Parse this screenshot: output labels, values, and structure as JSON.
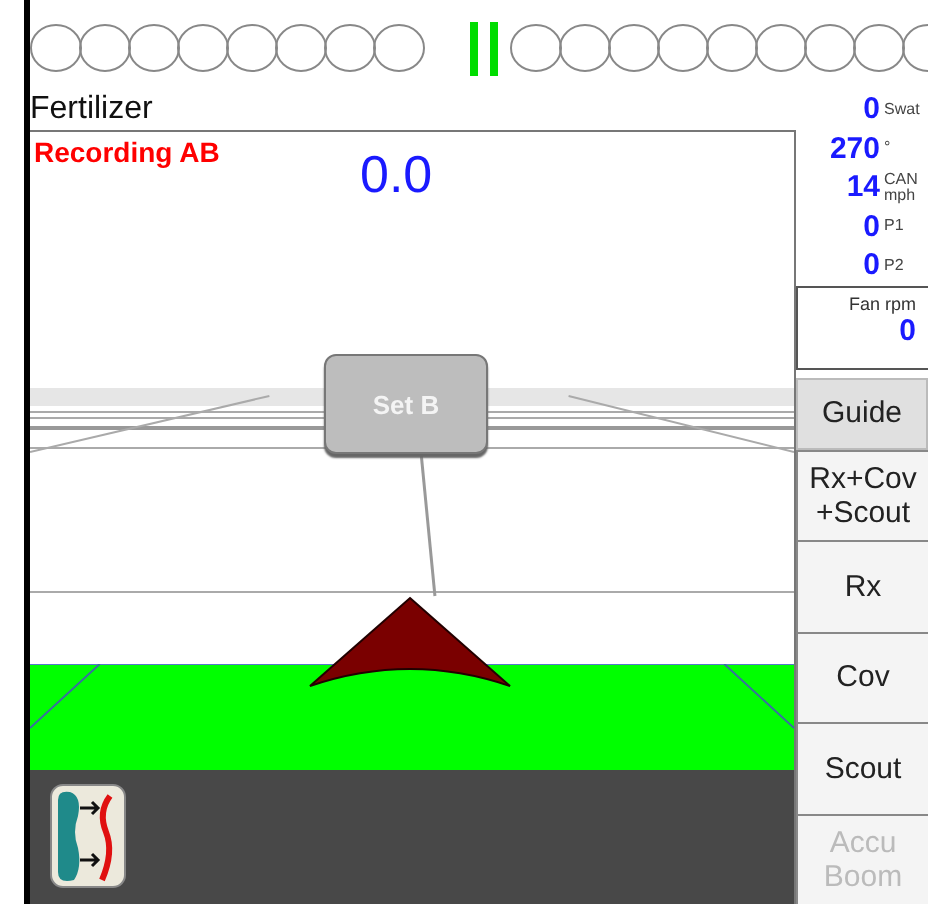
{
  "product": "Fertilizer",
  "view": {
    "status": "Recording AB",
    "value": "0.0",
    "set_button": "Set B"
  },
  "readouts": [
    {
      "value": "0",
      "unit": "Swat"
    },
    {
      "value": "270",
      "unit": "°"
    },
    {
      "value": "14",
      "unit": "CAN mph"
    },
    {
      "value": "0",
      "unit": "P1"
    },
    {
      "value": "0",
      "unit": "P2"
    }
  ],
  "fan": {
    "label": "Fan rpm",
    "value": "0"
  },
  "buttons": [
    {
      "label": "Guide",
      "kind": "guide",
      "disabled": false
    },
    {
      "label": "Rx+Cov +Scout",
      "kind": "mode",
      "disabled": false
    },
    {
      "label": "Rx",
      "kind": "mode",
      "disabled": false
    },
    {
      "label": "Cov",
      "kind": "mode",
      "disabled": false
    },
    {
      "label": "Scout",
      "kind": "mode",
      "disabled": false
    },
    {
      "label": "Accu Boom",
      "kind": "mode",
      "disabled": true
    }
  ]
}
